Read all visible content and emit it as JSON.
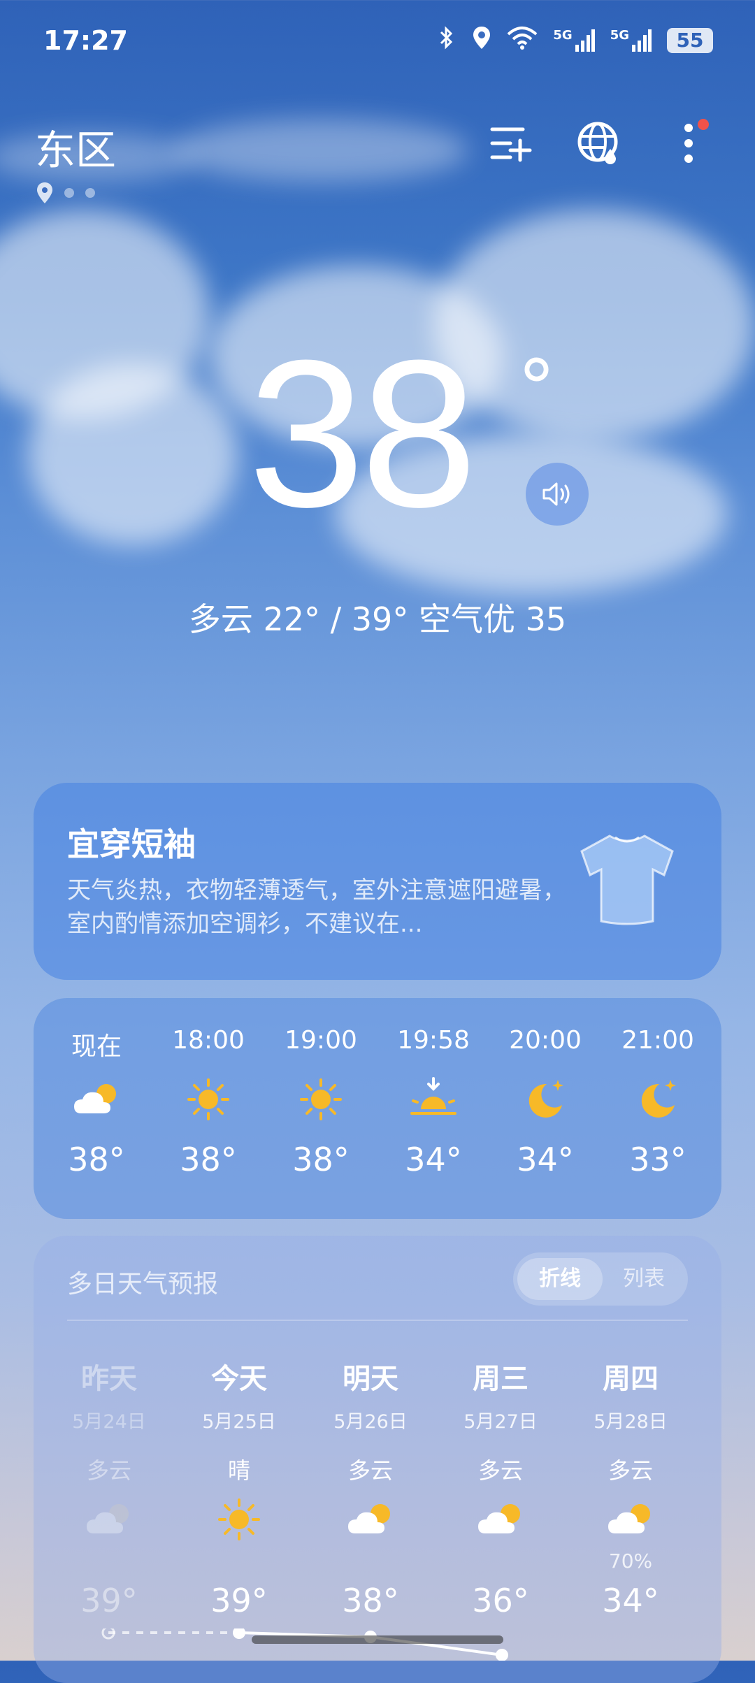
{
  "status_bar": {
    "time": "17:27",
    "network_1": "5G",
    "network_2": "5G",
    "battery": "55"
  },
  "header": {
    "city": "东区",
    "icons": [
      "add-city-icon",
      "globe-icon",
      "more-icon"
    ]
  },
  "current": {
    "temperature": "38",
    "degree": "°",
    "summary": "多云  22° / 39°  空气优 35"
  },
  "outfit": {
    "title": "宜穿短袖",
    "description": "天气炎热，衣物轻薄透气，室外注意遮阳避暑，室内酌情添加空调衫，不建议在..."
  },
  "hourly": [
    {
      "time": "现在",
      "icon": "partly-cloudy-day-icon",
      "temp": "38°"
    },
    {
      "time": "18:00",
      "icon": "sun-icon",
      "temp": "38°"
    },
    {
      "time": "19:00",
      "icon": "sun-icon",
      "temp": "38°"
    },
    {
      "time": "19:58",
      "icon": "sunset-icon",
      "temp": "34°"
    },
    {
      "time": "20:00",
      "icon": "moon-icon",
      "temp": "34°"
    },
    {
      "time": "21:00",
      "icon": "moon-icon",
      "temp": "33°"
    }
  ],
  "daily": {
    "title": "多日天气预报",
    "toggle_active": "折线",
    "toggle_inactive": "列表",
    "days": [
      {
        "name": "昨天",
        "date": "5月24日",
        "condition": "多云",
        "icon": "partly-cloudy-icon",
        "precip": "",
        "temp": "39°"
      },
      {
        "name": "今天",
        "date": "5月25日",
        "condition": "晴",
        "icon": "sun-icon",
        "precip": "",
        "temp": "39°"
      },
      {
        "name": "明天",
        "date": "5月26日",
        "condition": "多云",
        "icon": "partly-cloudy-icon",
        "precip": "",
        "temp": "38°"
      },
      {
        "name": "周三",
        "date": "5月27日",
        "condition": "多云",
        "icon": "partly-cloudy-icon",
        "precip": "",
        "temp": "36°"
      },
      {
        "name": "周四",
        "date": "5月28日",
        "condition": "多云",
        "icon": "partly-cloudy-icon",
        "precip": "70%",
        "temp": "34°"
      }
    ]
  },
  "colors": {
    "sun": "#f7b928",
    "badge": "#f0524a"
  }
}
